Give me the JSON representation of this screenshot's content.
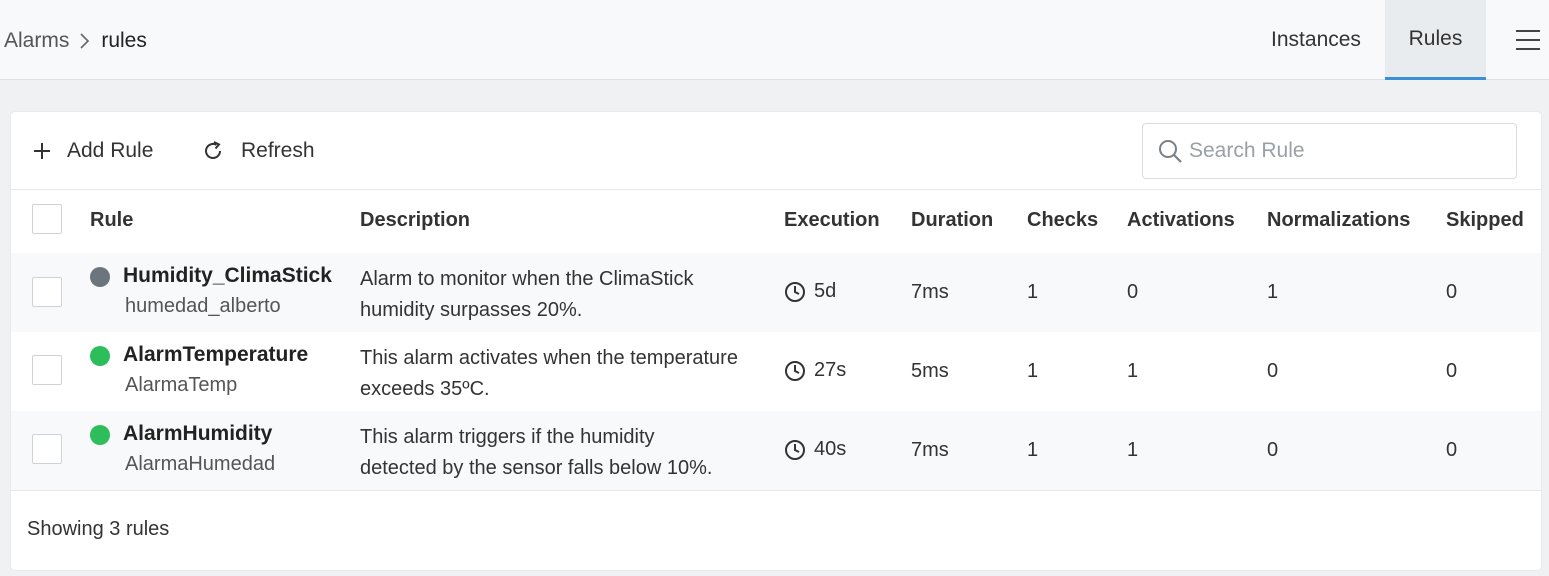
{
  "breadcrumb": {
    "root": "Alarms",
    "current": "rules"
  },
  "nav": {
    "instances": "Instances",
    "rules": "Rules"
  },
  "toolbar": {
    "add_label": "Add Rule",
    "refresh_label": "Refresh"
  },
  "search": {
    "placeholder": "Search Rule",
    "value": ""
  },
  "table": {
    "headers": {
      "rule": "Rule",
      "description": "Description",
      "execution": "Execution",
      "duration": "Duration",
      "checks": "Checks",
      "activations": "Activations",
      "normalizations": "Normalizations",
      "skipped": "Skipped"
    },
    "rows": [
      {
        "name": "Humidity_ClimaStick",
        "id": "humedad_alberto",
        "status_color": "#6c757d",
        "desc1": "Alarm to monitor when the ClimaStick",
        "desc2": "humidity surpasses 20%.",
        "execution": "5d",
        "duration": "7ms",
        "checks": "1",
        "activations": "0",
        "normalizations": "1",
        "skipped": "0"
      },
      {
        "name": "AlarmTemperature",
        "id": "AlarmaTemp",
        "status_color": "#2dbd5b",
        "desc1": "This alarm activates when the temperature",
        "desc2": "exceeds 35ºC.",
        "execution": "27s",
        "duration": "5ms",
        "checks": "1",
        "activations": "1",
        "normalizations": "0",
        "skipped": "0"
      },
      {
        "name": "AlarmHumidity",
        "id": "AlarmaHumedad",
        "status_color": "#2dbd5b",
        "desc1": "This alarm triggers if the humidity",
        "desc2": "detected by the sensor falls below 10%.",
        "execution": "40s",
        "duration": "7ms",
        "checks": "1",
        "activations": "1",
        "normalizations": "0",
        "skipped": "0"
      }
    ]
  },
  "footer": {
    "summary": "Showing 3 rules"
  },
  "colors": {
    "accent": "#3b8fd6",
    "inactive": "#6c757d",
    "active": "#2dbd5b"
  }
}
